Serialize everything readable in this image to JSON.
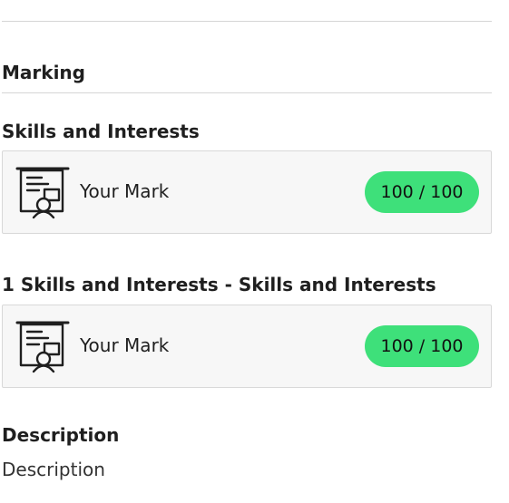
{
  "marking_section": {
    "title": "Marking"
  },
  "marks": [
    {
      "title": "Skills and Interests",
      "icon": "presentation-board-icon",
      "label": "Your Mark",
      "score": "100 / 100"
    },
    {
      "title": "1 Skills and Interests - Skills and Interests",
      "icon": "presentation-board-icon",
      "label": "Your Mark",
      "score": "100 / 100"
    }
  ],
  "description_section": {
    "title": "Description",
    "text": "Description"
  },
  "colors": {
    "score_badge": "#3ee07a",
    "card_background": "#f7f7f7",
    "divider": "#d6d6d6"
  }
}
